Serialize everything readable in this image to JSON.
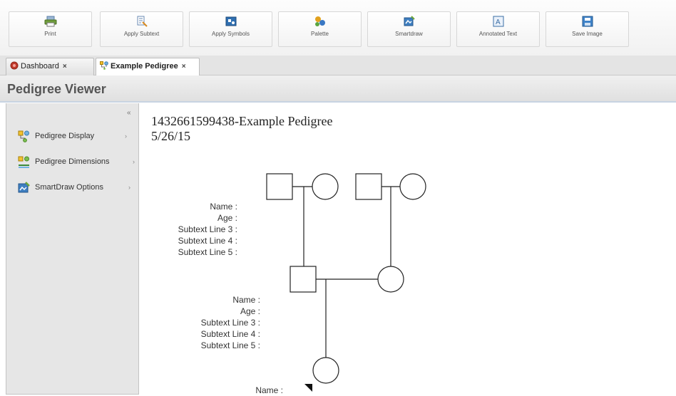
{
  "toolbar": {
    "buttons": [
      {
        "label": "Print",
        "icon": "printer-icon"
      },
      {
        "label": "Apply Subtext",
        "icon": "apply-subtext-icon"
      },
      {
        "label": "Apply Symbols",
        "icon": "apply-symbols-icon"
      },
      {
        "label": "Palette",
        "icon": "palette-icon"
      },
      {
        "label": "Smartdraw",
        "icon": "smartdraw-icon"
      },
      {
        "label": "Annotated Text",
        "icon": "annotated-text-icon"
      },
      {
        "label": "Save Image",
        "icon": "save-image-icon"
      }
    ]
  },
  "tabs": [
    {
      "label": "Dashboard",
      "close": "×",
      "icon": "dashboard-icon"
    },
    {
      "label": "Example Pedigree",
      "close": "×",
      "icon": "pedigree-icon",
      "active": true
    }
  ],
  "panel": {
    "title": "Pedigree Viewer"
  },
  "sidebar": {
    "collapse_glyph": "«",
    "items": [
      {
        "label": "Pedigree Display",
        "arrow": "›",
        "icon": "pedigree-display-icon"
      },
      {
        "label": "Pedigree Dimensions",
        "arrow": "›",
        "icon": "pedigree-dimensions-icon"
      },
      {
        "label": "SmartDraw Options",
        "arrow": "›",
        "icon": "smartdraw-options-icon"
      }
    ]
  },
  "pedigree": {
    "title": "1432661599438-Example Pedigree",
    "date": "5/26/15",
    "subtext_blocks": [
      {
        "lines": [
          "Name :",
          "Age :",
          "Subtext Line 3 :",
          "Subtext Line 4 :",
          "Subtext Line 5 :"
        ]
      },
      {
        "lines": [
          "Name :",
          "Age :",
          "Subtext Line 3 :",
          "Subtext Line 4 :",
          "Subtext Line 5 :"
        ]
      },
      {
        "lines": [
          "Name :"
        ]
      }
    ]
  },
  "colors": {
    "accent_border": "#c7d3e2",
    "sidebar_bg": "#e6e6e6",
    "dashboard_icon": "#c0392b",
    "pedigree_icon": "#d9a400"
  }
}
